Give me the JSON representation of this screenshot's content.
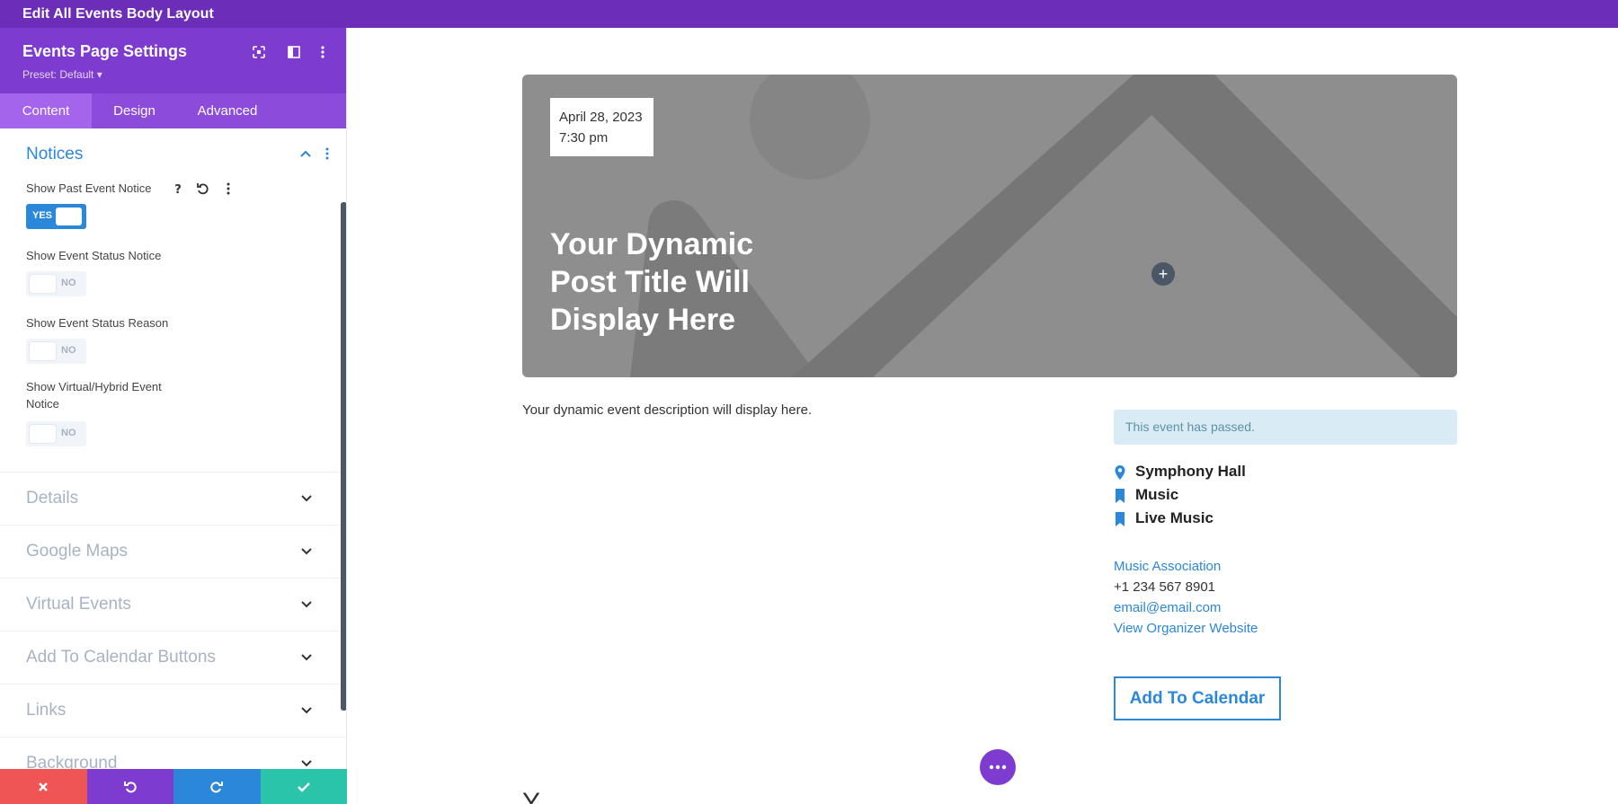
{
  "topbar": {
    "title": "Edit All Events Body Layout"
  },
  "panel": {
    "title": "Events Page Settings",
    "preset": "Preset: Default ▾",
    "header_icons": [
      "expand-icon",
      "sidebar-toggle-icon",
      "more-options-icon"
    ],
    "tabs": [
      {
        "label": "Content",
        "active": true
      },
      {
        "label": "Design",
        "active": false
      },
      {
        "label": "Advanced",
        "active": false
      }
    ],
    "open_section": {
      "title": "Notices",
      "options": [
        {
          "label": "Show Past Event Notice",
          "value": "YES",
          "on": true
        },
        {
          "label": "Show Event Status Notice",
          "value": "NO",
          "on": false
        },
        {
          "label": "Show Event Status Reason",
          "value": "NO",
          "on": false
        },
        {
          "label": "Show Virtual/Hybrid Event",
          "label2": "Notice",
          "value": "NO",
          "on": false
        }
      ],
      "option_icons": [
        "help-icon",
        "reset-icon",
        "more-options-icon"
      ]
    },
    "collapsed_sections": [
      "Details",
      "Google Maps",
      "Virtual Events",
      "Add To Calendar Buttons",
      "Links",
      "Background"
    ],
    "footer": [
      {
        "name": "discard",
        "color": "#ef5555"
      },
      {
        "name": "undo",
        "color": "#7e3bd0"
      },
      {
        "name": "redo",
        "color": "#2b87da"
      },
      {
        "name": "save",
        "color": "#29c4a9"
      }
    ]
  },
  "canvas": {
    "date": "April 28, 2023",
    "time": "7:30 pm",
    "hero_title": "Your Dynamic Post Title Will Display Here",
    "description": "Your dynamic event description will display here.",
    "notice": "This event has passed.",
    "meta": [
      {
        "icon": "location-pin-icon",
        "text": "Symphony Hall"
      },
      {
        "icon": "bookmark-icon",
        "text": "Music"
      },
      {
        "icon": "bookmark-icon",
        "text": "Live Music"
      }
    ],
    "organizer": {
      "name": "Music Association",
      "phone": "+1 234 567 8901",
      "email": "email@email.com",
      "website": "View Organizer Website"
    },
    "calendar_button": "Add To Calendar",
    "partial_heading": "Y"
  },
  "colors": {
    "topbar": "#6c2eb9",
    "panel_header": "#7e3bd0",
    "accent_blue": "#2b87da",
    "hero_gray": "#8e8e8e",
    "notice_bg": "#d9ecf5"
  }
}
